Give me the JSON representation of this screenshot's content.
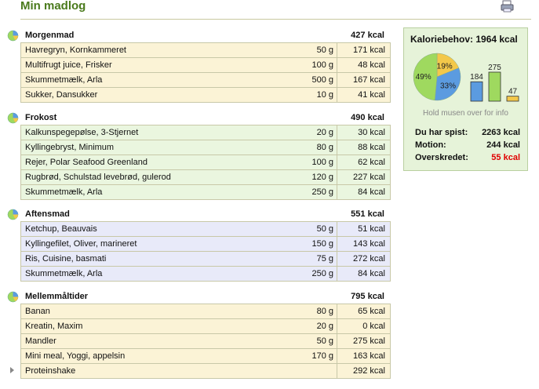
{
  "page": {
    "title": "Min madlog",
    "print_icon": "printer-icon"
  },
  "meals": [
    {
      "name": "Morgenmad",
      "total": "427 kcal",
      "icon": "meal-pie-icon",
      "color": "#fbf3d6",
      "items": [
        {
          "name": "Havregryn, Kornkammeret",
          "amount": "50 g",
          "kcal": "171 kcal"
        },
        {
          "name": "Multifrugt juice, Frisker",
          "amount": "100 g",
          "kcal": "48 kcal"
        },
        {
          "name": "Skummetmælk, Arla",
          "amount": "500 g",
          "kcal": "167 kcal"
        },
        {
          "name": "Sukker, Dansukker",
          "amount": "10 g",
          "kcal": "41 kcal"
        }
      ]
    },
    {
      "name": "Frokost",
      "total": "490 kcal",
      "icon": "meal-pie-icon",
      "color": "#eaf6df",
      "items": [
        {
          "name": "Kalkunspegepølse, 3-Stjernet",
          "amount": "20 g",
          "kcal": "30 kcal"
        },
        {
          "name": "Kyllingebryst, Minimum",
          "amount": "80 g",
          "kcal": "88 kcal"
        },
        {
          "name": "Rejer, Polar Seafood Greenland",
          "amount": "100 g",
          "kcal": "62 kcal"
        },
        {
          "name": "Rugbrød, Schulstad levebrød, gulerod",
          "amount": "120 g",
          "kcal": "227 kcal"
        },
        {
          "name": "Skummetmælk, Arla",
          "amount": "250 g",
          "kcal": "84 kcal"
        }
      ]
    },
    {
      "name": "Aftensmad",
      "total": "551 kcal",
      "icon": "meal-pie-icon",
      "color": "#e8eaf9",
      "items": [
        {
          "name": "Ketchup, Beauvais",
          "amount": "50 g",
          "kcal": "51 kcal"
        },
        {
          "name": "Kyllingefilet, Oliver, marineret",
          "amount": "150 g",
          "kcal": "143 kcal"
        },
        {
          "name": "Ris, Cuisine, basmati",
          "amount": "75 g",
          "kcal": "272 kcal"
        },
        {
          "name": "Skummetmælk, Arla",
          "amount": "250 g",
          "kcal": "84 kcal"
        }
      ]
    },
    {
      "name": "Mellemmåltider",
      "total": "795 kcal",
      "icon": "meal-pie-icon",
      "color": "#fbf3d6",
      "items": [
        {
          "name": "Banan",
          "amount": "80 g",
          "kcal": "65 kcal"
        },
        {
          "name": "Kreatin, Maxim",
          "amount": "20 g",
          "kcal": "0 kcal"
        },
        {
          "name": "Mandler",
          "amount": "50 g",
          "kcal": "275 kcal"
        },
        {
          "name": "Mini meal, Yoggi, appelsin",
          "amount": "170 g",
          "kcal": "163 kcal"
        },
        {
          "name": "Proteinshake",
          "amount": "",
          "kcal": "292 kcal",
          "expandable": true
        }
      ]
    }
  ],
  "summary": {
    "title": "Kaloriebehov: 1964 kcal",
    "pie": [
      {
        "label": "19%",
        "value": 19,
        "color": "#f3c84a"
      },
      {
        "label": "33%",
        "value": 33,
        "color": "#5b9be0"
      },
      {
        "label": "49%",
        "value": 49,
        "color": "#9fd95f"
      }
    ],
    "bars": [
      {
        "label": "184",
        "value": 184,
        "color": "#5b9be0"
      },
      {
        "label": "275",
        "value": 275,
        "color": "#9fd95f"
      },
      {
        "label": "47",
        "value": 47,
        "color": "#f3c84a"
      }
    ],
    "hint": "Hold musen over for info",
    "eaten_label": "Du har spist:",
    "eaten_value": "2263 kcal",
    "exercise_label": "Motion:",
    "exercise_value": "244 kcal",
    "exceeded_label": "Overskredet:",
    "exceeded_value": "55 kcal",
    "exceeded_color": "#e00000"
  }
}
